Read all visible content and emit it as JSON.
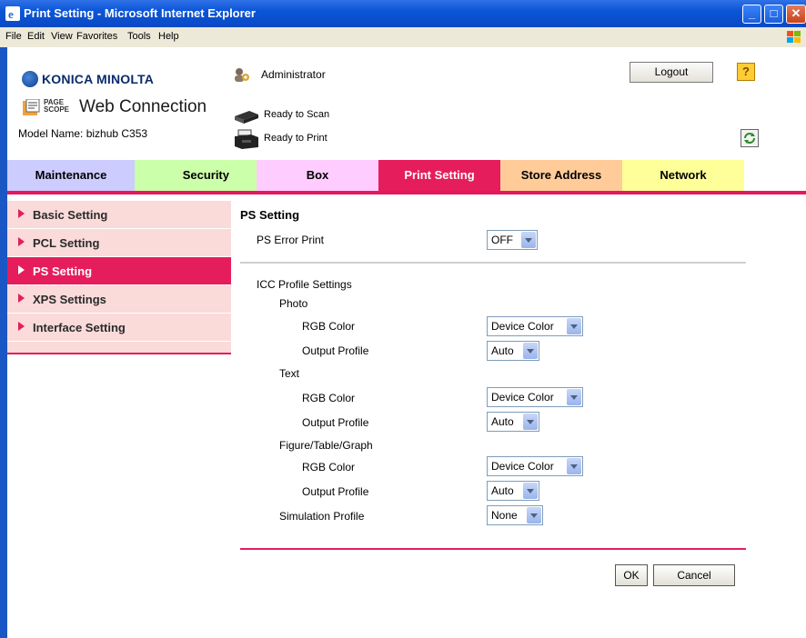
{
  "window": {
    "title": "Print Setting - Microsoft Internet Explorer"
  },
  "menu": [
    "File",
    "Edit",
    "View",
    "Favorites",
    "Tools",
    "Help"
  ],
  "header": {
    "brand": "KONICA MINOLTA",
    "ps_small_1": "PAGE",
    "ps_small_2": "SCOPE",
    "web_connection": "Web Connection",
    "model": "Model Name: bizhub C353",
    "user": "Administrator",
    "logout": "Logout",
    "help": "?",
    "status_scan": "Ready to Scan",
    "status_print": "Ready to Print"
  },
  "tabs": [
    {
      "label": "Maintenance",
      "color": "#ccccff"
    },
    {
      "label": "Security",
      "color": "#ccffaa"
    },
    {
      "label": "Box",
      "color": "#ffccff"
    },
    {
      "label": "Print Setting",
      "color": "#e61d5d",
      "active": true
    },
    {
      "label": "Store Address",
      "color": "#ffcc99"
    },
    {
      "label": "Network",
      "color": "#ffff99"
    }
  ],
  "nav": [
    {
      "label": "Basic Setting"
    },
    {
      "label": "PCL Setting"
    },
    {
      "label": "PS Setting",
      "active": true
    },
    {
      "label": "XPS Settings"
    },
    {
      "label": "Interface Setting"
    }
  ],
  "content": {
    "title": "PS Setting",
    "ps_error_print": {
      "label": "PS Error Print",
      "value": "OFF"
    },
    "icc_title": "ICC Profile Settings",
    "photo": "Photo",
    "text": "Text",
    "figure": "Figure/Table/Graph",
    "rgb_color": "RGB Color",
    "output_profile": "Output Profile",
    "photo_rgb": "Device Color",
    "photo_output": "Auto",
    "text_rgb": "Device Color",
    "text_output": "Auto",
    "figure_rgb": "Device Color",
    "figure_output": "Auto",
    "simulation_label": "Simulation Profile",
    "simulation_value": "None"
  },
  "buttons": {
    "ok": "OK",
    "cancel": "Cancel"
  },
  "colors": {
    "accent": "#e61d5d",
    "nav_bg": "#fbdada",
    "titlebar": "#0b55d8"
  }
}
